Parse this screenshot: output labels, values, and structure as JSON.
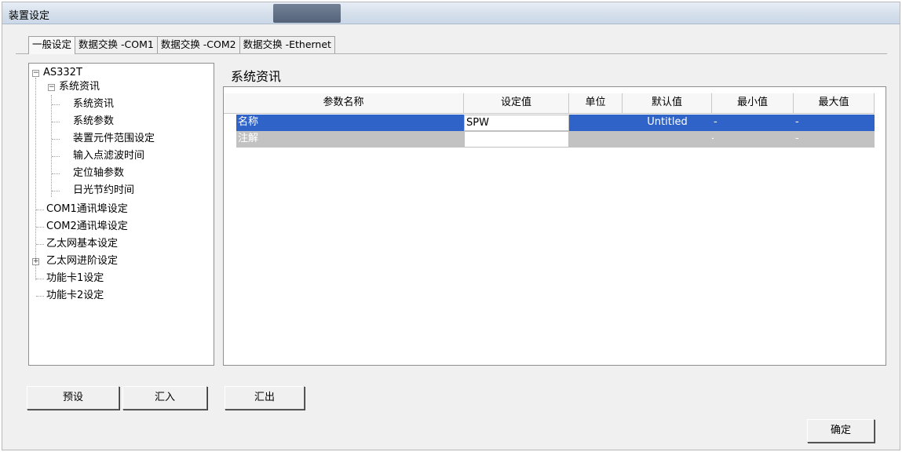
{
  "window": {
    "title": "装置设定"
  },
  "tabs": [
    {
      "label": "一般设定"
    },
    {
      "label": "数据交换 -COM1"
    },
    {
      "label": "数据交换 -COM2"
    },
    {
      "label": "数据交换 -Ethernet"
    }
  ],
  "tree": {
    "root": "AS332T",
    "group": "系统资讯",
    "children": [
      "系统资讯",
      "系统参数",
      "装置元件范围设定",
      "输入点滤波时间",
      "定位轴参数",
      "日光节约时间"
    ],
    "items": [
      "COM1通讯埠设定",
      "COM2通讯埠设定",
      "乙太网基本设定",
      "乙太网进阶设定",
      "功能卡1设定",
      "功能卡2设定"
    ]
  },
  "section_title": "系统资讯",
  "table": {
    "headers": [
      "参数名称",
      "设定值",
      "单位",
      "默认值",
      "最小值",
      "最大值"
    ],
    "rows": [
      {
        "name": "名称",
        "value": "SPW",
        "unit": "",
        "default": "Untitled",
        "min": "-",
        "max": "-"
      },
      {
        "name": "注解",
        "value": "",
        "unit": "",
        "default": "",
        "min": "-",
        "max": "-"
      }
    ]
  },
  "buttons": {
    "preset": "预设",
    "import": "汇入",
    "export": "汇出",
    "ok": "确定"
  },
  "colors": {
    "selection": "#3063c8",
    "row_gray": "#c2c2c2"
  }
}
